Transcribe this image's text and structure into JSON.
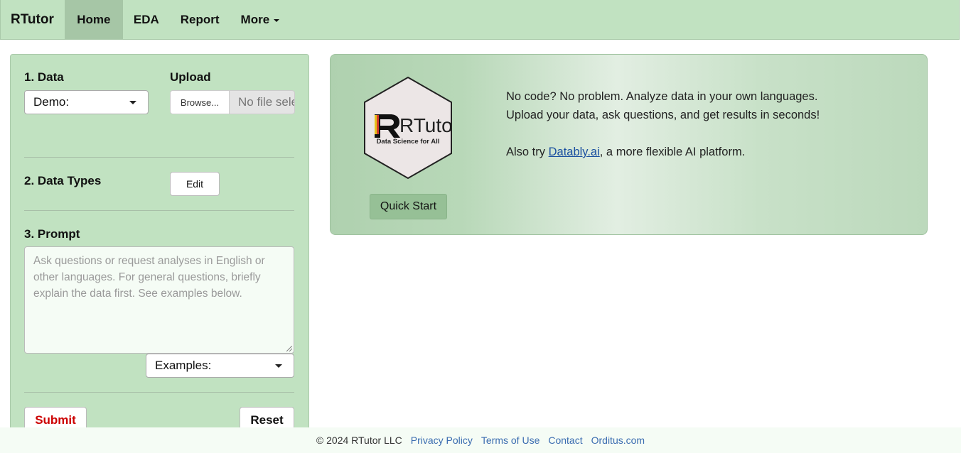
{
  "navbar": {
    "brand": "RTutor",
    "items": [
      {
        "label": "Home",
        "active": true
      },
      {
        "label": "EDA"
      },
      {
        "label": "Report"
      },
      {
        "label": "More"
      }
    ]
  },
  "sidebar": {
    "data_label": "1. Data",
    "demo_select": "Demo:",
    "upload_label": "Upload",
    "browse_label": "Browse...",
    "file_placeholder": "No file selected",
    "data_types_label": "2. Data Types",
    "edit_label": "Edit",
    "prompt_label": "3. Prompt",
    "prompt_placeholder": "Ask questions or request analyses in English or other languages. For general questions, briefly explain the data first. See examples below.",
    "examples_select": "Examples:",
    "submit_label": "Submit",
    "reset_label": "Reset"
  },
  "hero": {
    "logo_text": "RTutor",
    "logo_subtitle": "Data Science for All",
    "quick_start_label": "Quick Start",
    "line1": "No code? No problem. Analyze data in your own languages.",
    "line2": "Upload your data, ask questions, and get results in seconds!",
    "also_prefix": "Also try ",
    "also_link": "Datably.ai",
    "also_suffix": ", a more flexible AI platform."
  },
  "footer": {
    "copyright": "© 2024 RTutor LLC",
    "links": [
      "Privacy Policy",
      "Terms of Use",
      "Contact",
      "Orditus.com"
    ]
  },
  "colors": {
    "nav_bg": "#c1e2c1",
    "active_tab": "#a6c6a6",
    "submit_text": "#cc0000",
    "link": "#1a4fa0"
  }
}
